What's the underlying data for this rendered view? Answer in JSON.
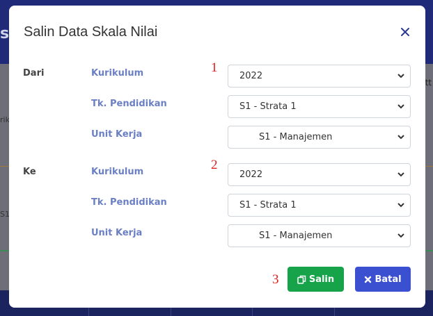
{
  "background": {
    "header_fragment": "s",
    "right_fragment": "tt",
    "left_fragment_1": "rik",
    "left_fragment_2": "S1 -"
  },
  "modal": {
    "title": "Salin Data Skala Nilai",
    "close_icon": "close-icon",
    "dari": {
      "section_label": "Dari",
      "marker": "1",
      "kurikulum": {
        "label": "Kurikulum",
        "value": "2022"
      },
      "tk_pendidikan": {
        "label": "Tk. Pendidikan",
        "value": "S1 - Strata 1"
      },
      "unit_kerja": {
        "label": "Unit Kerja",
        "value": "S1 - Manajemen"
      }
    },
    "ke": {
      "section_label": "Ke",
      "marker": "2",
      "kurikulum": {
        "label": "Kurikulum",
        "value": "2022"
      },
      "tk_pendidikan": {
        "label": "Tk. Pendidikan",
        "value": "S1 - Strata 1"
      },
      "unit_kerja": {
        "label": "Unit Kerja",
        "value": "S1 - Manajemen"
      }
    },
    "footer": {
      "marker": "3",
      "salin_label": "Salin",
      "salin_icon": "copy-icon",
      "batal_label": "Batal",
      "batal_icon": "x-icon"
    }
  },
  "colors": {
    "primary_button": "#3b4fd1",
    "success_button": "#16a34a",
    "label_blue": "#6b7fc4",
    "marker_red": "#e02020",
    "title_dark": "#333333"
  }
}
